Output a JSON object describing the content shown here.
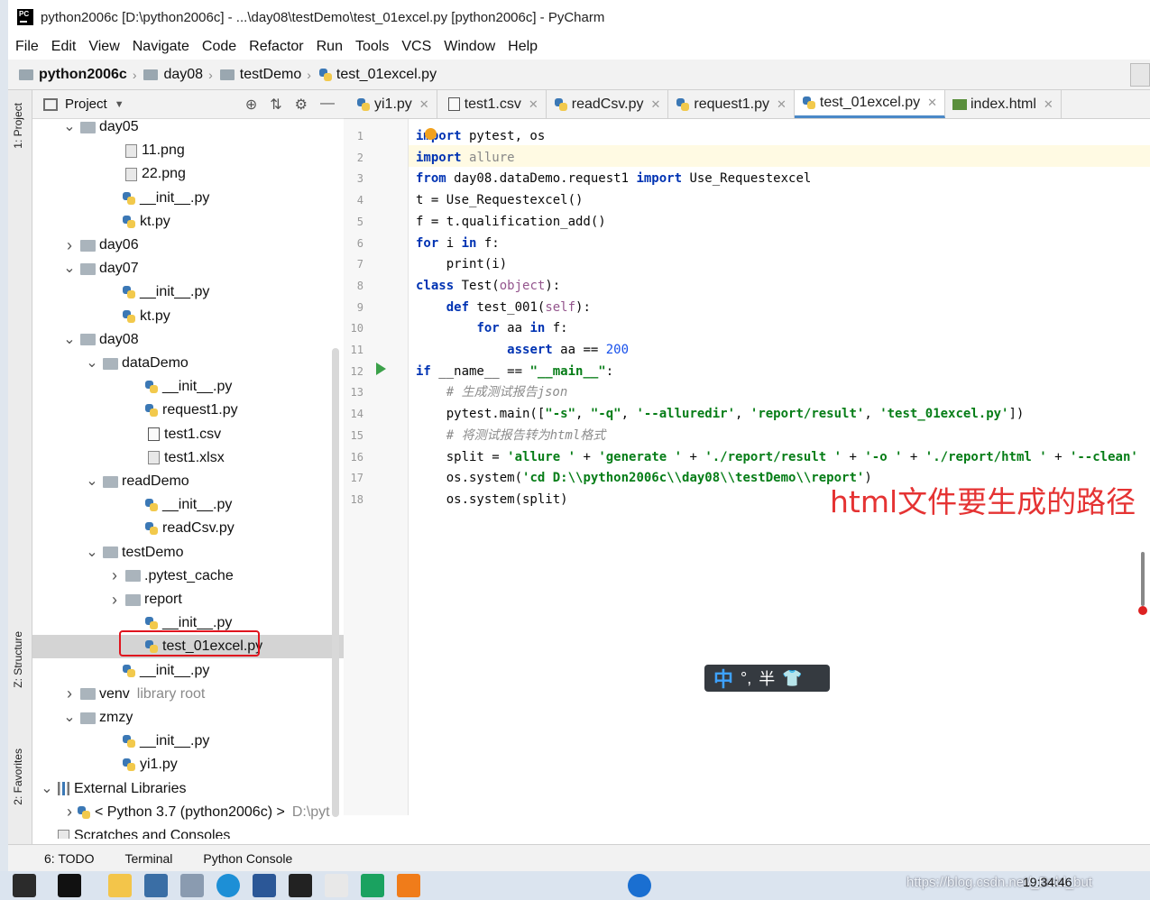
{
  "window": {
    "title": "python2006c [D:\\python2006c] - ...\\day08\\testDemo\\test_01excel.py [python2006c] - PyCharm",
    "app_logo_text": "PC"
  },
  "menu": [
    "File",
    "Edit",
    "View",
    "Navigate",
    "Code",
    "Refactor",
    "Run",
    "Tools",
    "VCS",
    "Window",
    "Help"
  ],
  "breadcrumb": [
    "python2006c",
    "day08",
    "testDemo",
    "test_01excel.py"
  ],
  "side_tabs": {
    "project": "1: Project",
    "structure": "Z: Structure",
    "favorites": "2: Favorites"
  },
  "project_panel": {
    "title": "Project"
  },
  "tree": [
    {
      "label": "day05",
      "kind": "folder",
      "arrow": "v",
      "indent": 1
    },
    {
      "label": "11.png",
      "kind": "img",
      "indent": 3
    },
    {
      "label": "22.png",
      "kind": "img",
      "indent": 3
    },
    {
      "label": "__init__.py",
      "kind": "py",
      "indent": 3
    },
    {
      "label": "kt.py",
      "kind": "py",
      "indent": 3
    },
    {
      "label": "day06",
      "kind": "folder",
      "arrow": ">",
      "indent": 1
    },
    {
      "label": "day07",
      "kind": "folder",
      "arrow": "v",
      "indent": 1
    },
    {
      "label": "__init__.py",
      "kind": "py",
      "indent": 3
    },
    {
      "label": "kt.py",
      "kind": "py",
      "indent": 3
    },
    {
      "label": "day08",
      "kind": "folder",
      "arrow": "v",
      "indent": 1
    },
    {
      "label": "dataDemo",
      "kind": "folder",
      "arrow": "v",
      "indent": 2
    },
    {
      "label": "__init__.py",
      "kind": "py",
      "indent": 4
    },
    {
      "label": "request1.py",
      "kind": "py",
      "indent": 4
    },
    {
      "label": "test1.csv",
      "kind": "csv",
      "indent": 4
    },
    {
      "label": "test1.xlsx",
      "kind": "file",
      "indent": 4
    },
    {
      "label": "readDemo",
      "kind": "folder",
      "arrow": "v",
      "indent": 2
    },
    {
      "label": "__init__.py",
      "kind": "py",
      "indent": 4
    },
    {
      "label": "readCsv.py",
      "kind": "py",
      "indent": 4
    },
    {
      "label": "testDemo",
      "kind": "folder",
      "arrow": "v",
      "indent": 2
    },
    {
      "label": ".pytest_cache",
      "kind": "folder",
      "arrow": ">",
      "indent": 3
    },
    {
      "label": "report",
      "kind": "folder",
      "arrow": ">",
      "indent": 3
    },
    {
      "label": "__init__.py",
      "kind": "py",
      "indent": 4
    },
    {
      "label": "test_01excel.py",
      "kind": "py",
      "indent": 4,
      "selected": true
    },
    {
      "label": "__init__.py",
      "kind": "py",
      "indent": 3
    },
    {
      "label": "venv",
      "kind": "folder",
      "arrow": ">",
      "indent": 1,
      "note": "library root"
    },
    {
      "label": "zmzy",
      "kind": "folder",
      "arrow": "v",
      "indent": 1
    },
    {
      "label": "__init__.py",
      "kind": "py",
      "indent": 3
    },
    {
      "label": "yi1.py",
      "kind": "py",
      "indent": 3
    },
    {
      "label": "External Libraries",
      "kind": "lib",
      "arrow": "v",
      "indent": 0
    },
    {
      "label": "< Python 3.7 (python2006c) >",
      "kind": "py",
      "arrow": ">",
      "indent": 1,
      "note": "D:\\pyt"
    },
    {
      "label": "Scratches and Consoles",
      "kind": "scratch",
      "indent": 0
    }
  ],
  "tabs": [
    {
      "label": "yi1.py",
      "kind": "py"
    },
    {
      "label": "test1.csv",
      "kind": "csv"
    },
    {
      "label": "readCsv.py",
      "kind": "py"
    },
    {
      "label": "request1.py",
      "kind": "py"
    },
    {
      "label": "test_01excel.py",
      "kind": "py",
      "active": true
    },
    {
      "label": "index.html",
      "kind": "html"
    }
  ],
  "code_lines": [
    "<span class='kw'>import</span> pytest, os",
    "<span class='kw'>import</span> <span style='color:#888'>allure</span>",
    "<span class='kw'>from</span> day08.dataDemo.request1 <span class='kw'>import</span> Use_Requestexcel",
    "t = Use_Requestexcel()",
    "f = t.qualification_add()",
    "<span class='kw'>for</span> i <span class='kw'>in</span> f:",
    "    print(i)",
    "<span class='kw'>class</span> Test(<span class='self'>object</span>):",
    "    <span class='kw'>def</span> test_001(<span class='self'>self</span>):",
    "        <span class='kw'>for</span> aa <span class='kw'>in</span> f:",
    "            <span class='kw'>assert</span> aa == <span class='num'>200</span>",
    "<span class='kw'>if</span> __name__ == <span class='str'>\"__main__\"</span>:",
    "    <span class='cmt'># 生成测试报告json</span>",
    "    pytest.main([<span class='str'>\"-s\"</span>, <span class='str'>\"-q\"</span>, <span class='str'>'--alluredir'</span>, <span class='str'>'report/result'</span>, <span class='str'>'test_01excel.py'</span>])",
    "    <span class='cmt'># 将测试报告转为html格式</span>",
    "    split = <span class='str'>'allure '</span> + <span class='str'>'generate '</span> + <span class='str'>'./report/result '</span> + <span class='str'>'-o '</span> + <span class='str'>'./report/html '</span> + <span class='str'>'--clean'</span>",
    "    os.system(<span class='str'>'cd D:\\\\python2006c\\\\day08\\\\testDemo\\\\report'</span>)",
    "    os.system(split)"
  ],
  "annotation": "html文件要生成的路径",
  "ime": {
    "mode": "中",
    "punct": "°,",
    "width": "半"
  },
  "bottom_tabs": [
    "6: TODO",
    "Terminal",
    "Python Console"
  ],
  "watermark": "https://blog.csdn.net/_Bald_but",
  "clock": "19:34:46"
}
